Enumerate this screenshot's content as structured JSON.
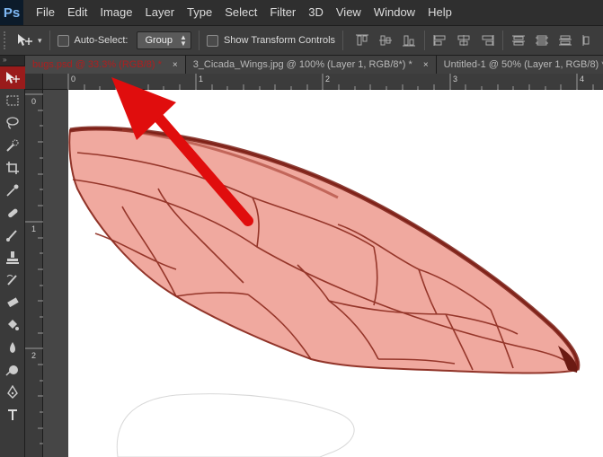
{
  "app": {
    "logo": "Ps"
  },
  "menu": [
    "File",
    "Edit",
    "Image",
    "Layer",
    "Type",
    "Select",
    "Filter",
    "3D",
    "View",
    "Window",
    "Help"
  ],
  "options": {
    "tool_icon": "move-icon",
    "auto_select_label": "Auto-Select:",
    "auto_select_value": "Group",
    "show_transform_label": "Show Transform Controls"
  },
  "tabs": [
    {
      "label": "bugs.psd @ 33.3% (RGB/8) *",
      "active": true,
      "close": "×"
    },
    {
      "label": "3_Cicada_Wings.jpg @ 100% (Layer 1, RGB/8*) *",
      "active": false,
      "close": "×"
    },
    {
      "label": "Untitled-1 @ 50% (Layer 1, RGB/8) *",
      "active": false,
      "close": "×"
    }
  ],
  "ruler": {
    "top_labels": [
      "0",
      "1",
      "2",
      "3",
      "4"
    ],
    "left_labels": [
      "0",
      "1",
      "2"
    ]
  },
  "colors": {
    "accent_red": "#b01e1e",
    "wing_fill": "#f0a59a",
    "wing_vein": "#8c2a1e",
    "arrow": "#e00d0d"
  },
  "tools": [
    "move-icon",
    "marquee-icon",
    "lasso-icon",
    "quick-select-icon",
    "crop-icon",
    "eyedropper-icon",
    "healing-brush-icon",
    "brush-icon",
    "clone-stamp-icon",
    "history-brush-icon",
    "eraser-icon",
    "paint-bucket-icon",
    "blur-icon",
    "dodge-icon",
    "pen-icon",
    "type-icon"
  ]
}
